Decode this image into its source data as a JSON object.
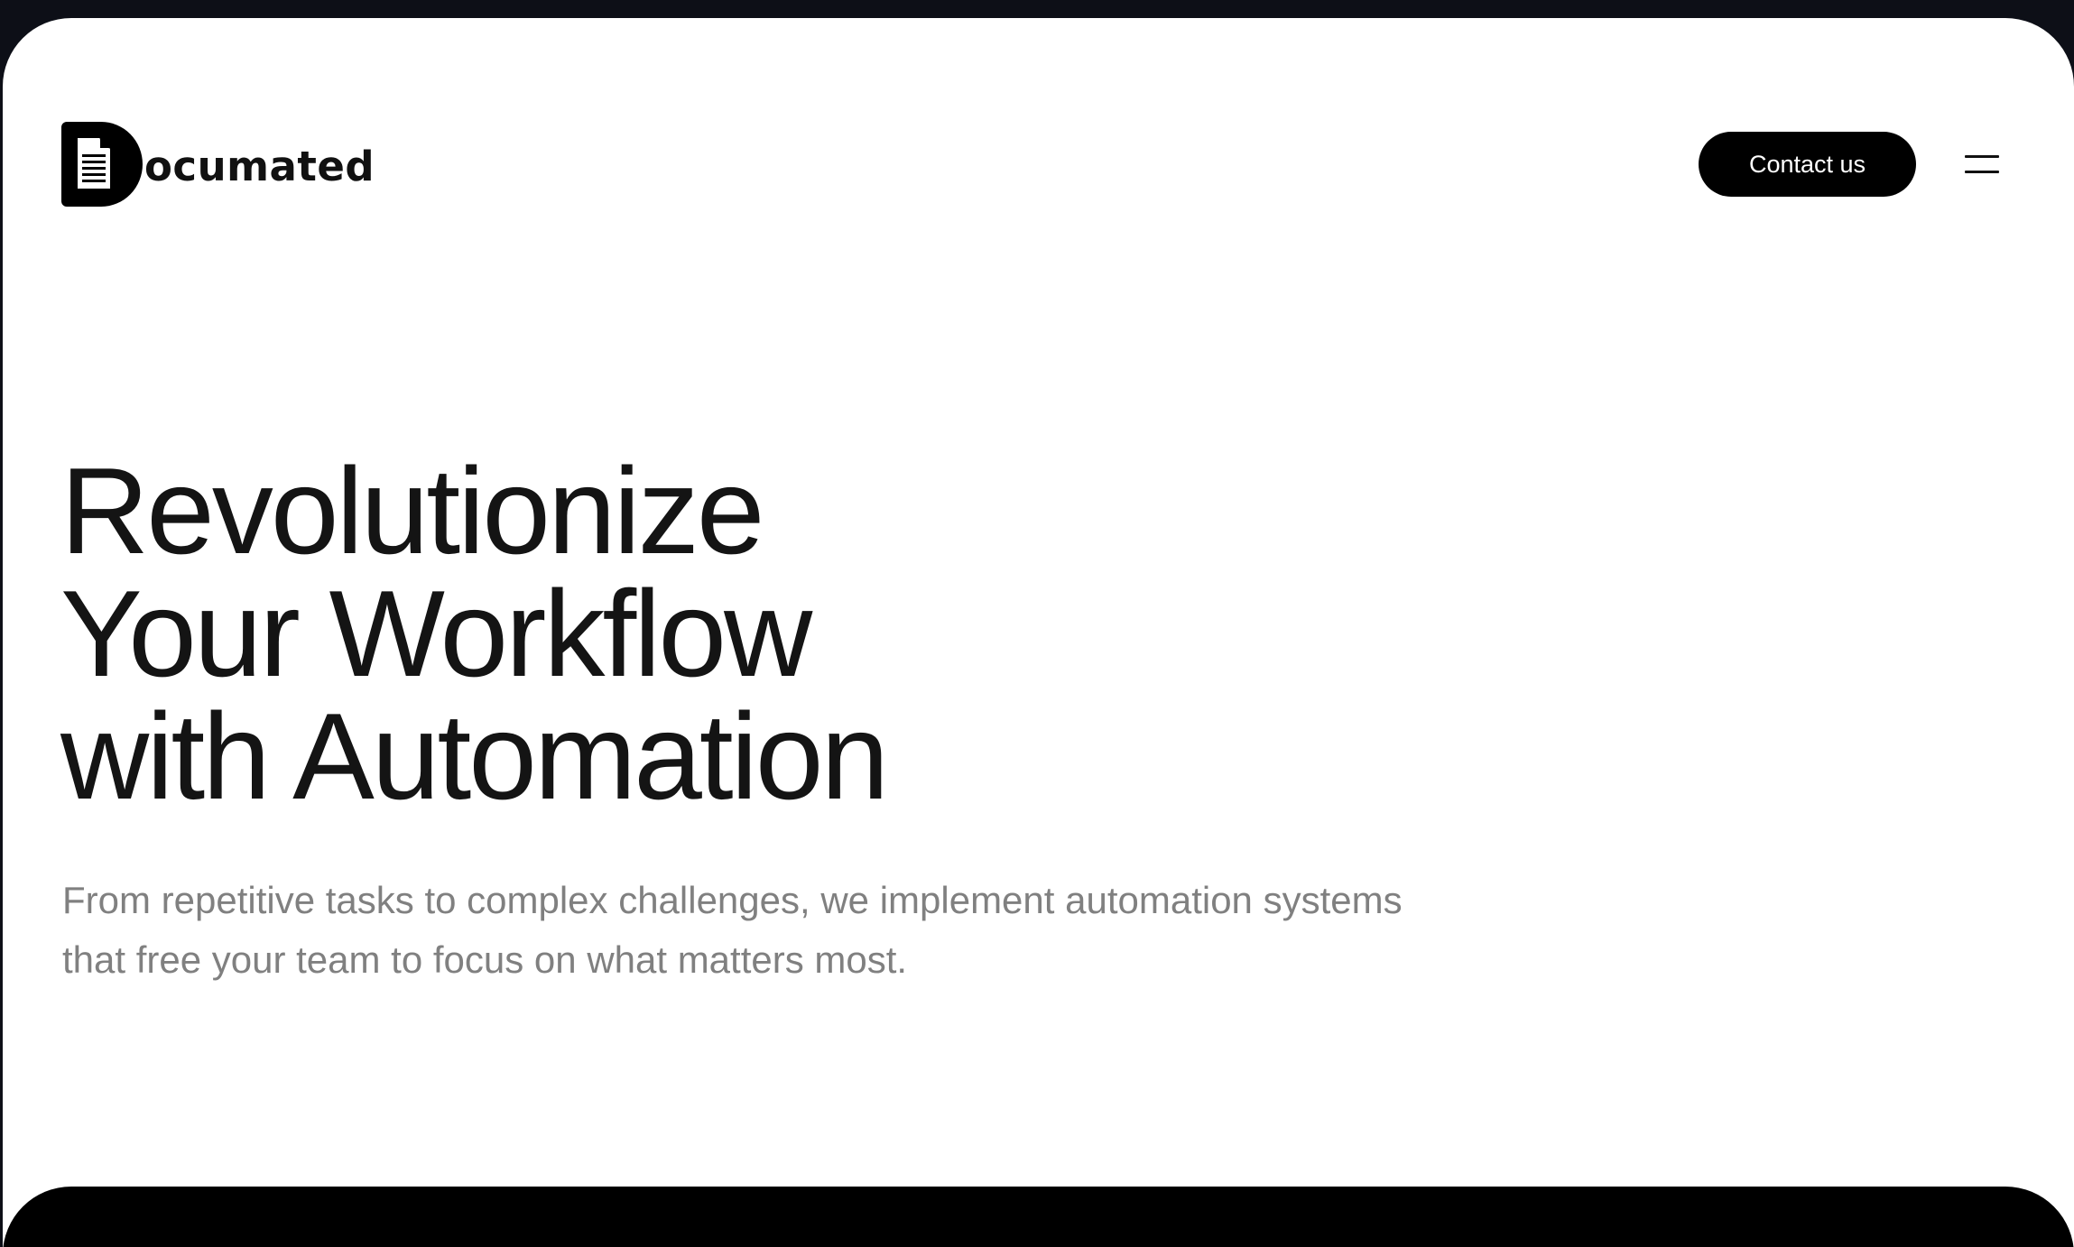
{
  "brand": {
    "name": "ocumated",
    "logo_letter": "D"
  },
  "header": {
    "contact_label": "Contact us",
    "menu_icon": "hamburger-icon"
  },
  "hero": {
    "title_lines": [
      "Revolutionize",
      "Your Workflow",
      "with Automation"
    ],
    "subtitle": "From repetitive tasks to complex challenges, we implement automation systems that free your team to focus on what matters most."
  },
  "colors": {
    "background": "#ffffff",
    "outer": "#0d0f17",
    "accent": "#000000",
    "heading": "#141414",
    "subtitle": "#808080"
  }
}
